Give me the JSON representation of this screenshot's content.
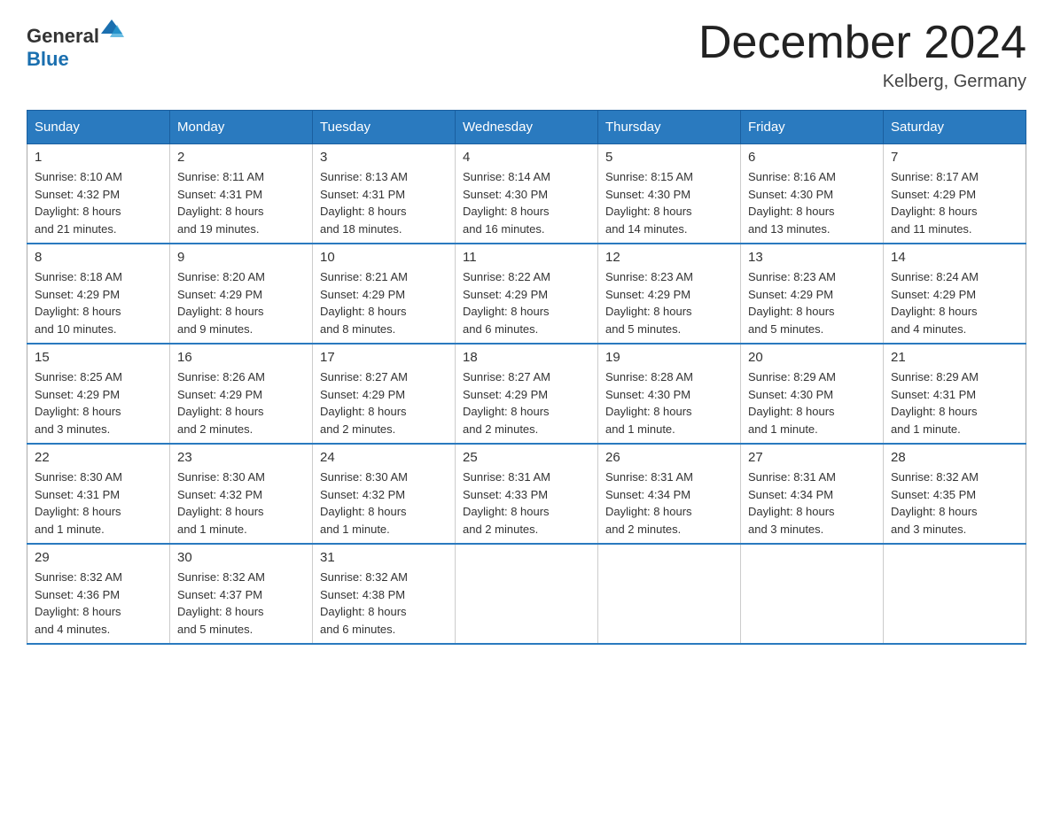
{
  "logo": {
    "text_general": "General",
    "text_blue": "Blue"
  },
  "title": "December 2024",
  "location": "Kelberg, Germany",
  "days_of_week": [
    "Sunday",
    "Monday",
    "Tuesday",
    "Wednesday",
    "Thursday",
    "Friday",
    "Saturday"
  ],
  "weeks": [
    [
      {
        "day": "1",
        "sunrise": "8:10 AM",
        "sunset": "4:32 PM",
        "daylight": "8 hours and 21 minutes."
      },
      {
        "day": "2",
        "sunrise": "8:11 AM",
        "sunset": "4:31 PM",
        "daylight": "8 hours and 19 minutes."
      },
      {
        "day": "3",
        "sunrise": "8:13 AM",
        "sunset": "4:31 PM",
        "daylight": "8 hours and 18 minutes."
      },
      {
        "day": "4",
        "sunrise": "8:14 AM",
        "sunset": "4:30 PM",
        "daylight": "8 hours and 16 minutes."
      },
      {
        "day": "5",
        "sunrise": "8:15 AM",
        "sunset": "4:30 PM",
        "daylight": "8 hours and 14 minutes."
      },
      {
        "day": "6",
        "sunrise": "8:16 AM",
        "sunset": "4:30 PM",
        "daylight": "8 hours and 13 minutes."
      },
      {
        "day": "7",
        "sunrise": "8:17 AM",
        "sunset": "4:29 PM",
        "daylight": "8 hours and 11 minutes."
      }
    ],
    [
      {
        "day": "8",
        "sunrise": "8:18 AM",
        "sunset": "4:29 PM",
        "daylight": "8 hours and 10 minutes."
      },
      {
        "day": "9",
        "sunrise": "8:20 AM",
        "sunset": "4:29 PM",
        "daylight": "8 hours and 9 minutes."
      },
      {
        "day": "10",
        "sunrise": "8:21 AM",
        "sunset": "4:29 PM",
        "daylight": "8 hours and 8 minutes."
      },
      {
        "day": "11",
        "sunrise": "8:22 AM",
        "sunset": "4:29 PM",
        "daylight": "8 hours and 6 minutes."
      },
      {
        "day": "12",
        "sunrise": "8:23 AM",
        "sunset": "4:29 PM",
        "daylight": "8 hours and 5 minutes."
      },
      {
        "day": "13",
        "sunrise": "8:23 AM",
        "sunset": "4:29 PM",
        "daylight": "8 hours and 5 minutes."
      },
      {
        "day": "14",
        "sunrise": "8:24 AM",
        "sunset": "4:29 PM",
        "daylight": "8 hours and 4 minutes."
      }
    ],
    [
      {
        "day": "15",
        "sunrise": "8:25 AM",
        "sunset": "4:29 PM",
        "daylight": "8 hours and 3 minutes."
      },
      {
        "day": "16",
        "sunrise": "8:26 AM",
        "sunset": "4:29 PM",
        "daylight": "8 hours and 2 minutes."
      },
      {
        "day": "17",
        "sunrise": "8:27 AM",
        "sunset": "4:29 PM",
        "daylight": "8 hours and 2 minutes."
      },
      {
        "day": "18",
        "sunrise": "8:27 AM",
        "sunset": "4:29 PM",
        "daylight": "8 hours and 2 minutes."
      },
      {
        "day": "19",
        "sunrise": "8:28 AM",
        "sunset": "4:30 PM",
        "daylight": "8 hours and 1 minute."
      },
      {
        "day": "20",
        "sunrise": "8:29 AM",
        "sunset": "4:30 PM",
        "daylight": "8 hours and 1 minute."
      },
      {
        "day": "21",
        "sunrise": "8:29 AM",
        "sunset": "4:31 PM",
        "daylight": "8 hours and 1 minute."
      }
    ],
    [
      {
        "day": "22",
        "sunrise": "8:30 AM",
        "sunset": "4:31 PM",
        "daylight": "8 hours and 1 minute."
      },
      {
        "day": "23",
        "sunrise": "8:30 AM",
        "sunset": "4:32 PM",
        "daylight": "8 hours and 1 minute."
      },
      {
        "day": "24",
        "sunrise": "8:30 AM",
        "sunset": "4:32 PM",
        "daylight": "8 hours and 1 minute."
      },
      {
        "day": "25",
        "sunrise": "8:31 AM",
        "sunset": "4:33 PM",
        "daylight": "8 hours and 2 minutes."
      },
      {
        "day": "26",
        "sunrise": "8:31 AM",
        "sunset": "4:34 PM",
        "daylight": "8 hours and 2 minutes."
      },
      {
        "day": "27",
        "sunrise": "8:31 AM",
        "sunset": "4:34 PM",
        "daylight": "8 hours and 3 minutes."
      },
      {
        "day": "28",
        "sunrise": "8:32 AM",
        "sunset": "4:35 PM",
        "daylight": "8 hours and 3 minutes."
      }
    ],
    [
      {
        "day": "29",
        "sunrise": "8:32 AM",
        "sunset": "4:36 PM",
        "daylight": "8 hours and 4 minutes."
      },
      {
        "day": "30",
        "sunrise": "8:32 AM",
        "sunset": "4:37 PM",
        "daylight": "8 hours and 5 minutes."
      },
      {
        "day": "31",
        "sunrise": "8:32 AM",
        "sunset": "4:38 PM",
        "daylight": "8 hours and 6 minutes."
      },
      null,
      null,
      null,
      null
    ]
  ],
  "labels": {
    "sunrise": "Sunrise:",
    "sunset": "Sunset:",
    "daylight": "Daylight:"
  }
}
